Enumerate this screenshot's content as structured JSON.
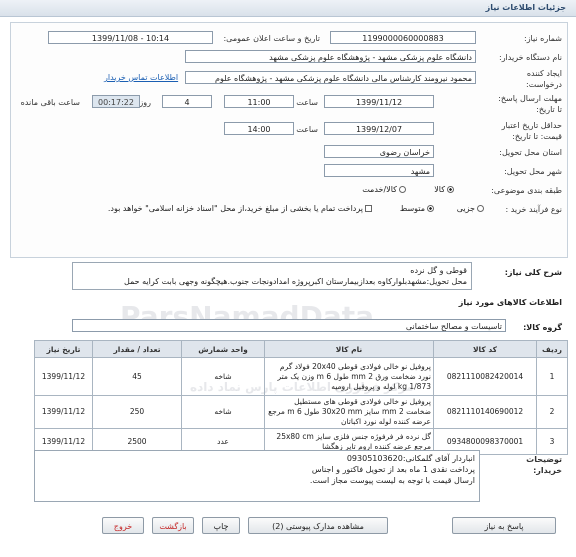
{
  "window": {
    "title": "جزئیات اطلاعات نیاز"
  },
  "form": {
    "need_number_label": "شماره نیاز:",
    "need_number": "1199000060000883",
    "announce_label": "تاریخ و ساعت اعلان عمومی:",
    "announce_value": "1399/11/08 - 10:14",
    "buyer_label": "نام دستگاه خریدار:",
    "buyer_value": "دانشگاه علوم پزشکی مشهد - پژوهشگاه علوم پزشکی مشهد",
    "creator_label_1": "ایجاد کننده",
    "creator_label_2": "درخواست:",
    "creator_value": "محمود نیرومند کارشناس مالی دانشگاه علوم پزشکی مشهد - پژوهشگاه علوم",
    "contact_link": "اطلاعات تماس خریدار",
    "reply_label_1": "مهلت ارسال پاسخ:",
    "reply_label_2": "تا تاریخ:",
    "reply_date": "1399/11/12",
    "time_label": "ساعت",
    "reply_time": "11:00",
    "days": "4",
    "days_label": "روز و",
    "remaining_time": "00:17:22",
    "remaining_label": "ساعت باقی مانده",
    "min_validity_label_1": "حداقل تاریخ اعتبار",
    "min_validity_label_2": "قیمت: تا تاریخ:",
    "validity_date": "1399/12/07",
    "validity_time": "14:00",
    "province_label": "استان محل تحویل:",
    "province": "خراسان رضوی",
    "city_label": "شهر محل تحویل:",
    "city": "مشهد",
    "category_label": "طبقه بندی موضوعی:",
    "category_options": [
      "کالا",
      "کالا/خدمت"
    ],
    "purchase_type_label": "نوع فرآیند خرید :",
    "purchase_options": [
      "جزیی",
      "متوسط"
    ],
    "payment_note": "پرداخت تمام یا بخشی از مبلغ خرید،از محل \"اسناد خزانه اسلامی\" خواهد بود."
  },
  "summary": {
    "label": "شرح کلی نیاز:",
    "text": "قوطی و گل نرده\nمحل تحویل:مشهدبلوارکاوه بعدازبیمارستان اکبرپروژه امدادونجات جنوب.هیچگونه وجهی بابت کرایه حمل"
  },
  "goods": {
    "section_title": "اطلاعات کالاهای مورد نیاز",
    "group_label": "گروه کالا:",
    "group_value": "تاسیسات و مصالح ساختمانی",
    "columns": [
      "ردیف",
      "کد کالا",
      "نام کالا",
      "واحد شمارش",
      "تعداد / مقدار",
      "تاریخ نیاز"
    ],
    "rows": [
      {
        "idx": "1",
        "code": "0821110082420014",
        "name": "پروفیل نو خالی فولادی قوطی 20x40 فولاد گرم نورد ضخامت ورق 2 mm طول 6 m وزن یک متر 1/873 kg لوله و پروفیل ارومیه",
        "unit": "شاخه",
        "qty": "45",
        "date": "1399/11/12"
      },
      {
        "idx": "2",
        "code": "0821110140690012",
        "name": "پروفیل نو خالی فولادی قوطی های مستطیل ضخامت 2 mm سایز 30x20 mm طول 6 m مرجع عرضه کننده لوله نورد اکباتان",
        "unit": "شاخه",
        "qty": "250",
        "date": "1399/11/12"
      },
      {
        "idx": "3",
        "code": "0934800098370001",
        "name": "گل نرده فر فرفوژه جنس فلزی سایز 25x80 cm مرجع عرضه کننده اروم تایر زهگشا",
        "unit": "عدد",
        "qty": "2500",
        "date": "1399/11/12"
      }
    ]
  },
  "buyer_notes": {
    "label_1": "توضیحات",
    "label_2": "خریدار:",
    "text": "انباردار آقای گلمکانی:09305103620\nپرداخت نقدی 1 ماه بعد از تحویل فاکتور و اجناس\nارسال قیمت با توجه به لیست پیوست مجاز است."
  },
  "buttons": {
    "reply": "پاسخ به نیاز",
    "docs": "مشاهده مدارک پیوستی (2)",
    "print": "چاپ",
    "back": "بازگشت",
    "exit": "خروج"
  },
  "watermark": {
    "text": "ParsNamadData",
    "sub": "مرکز فراوری اطلاعات پارس نماد داده"
  }
}
